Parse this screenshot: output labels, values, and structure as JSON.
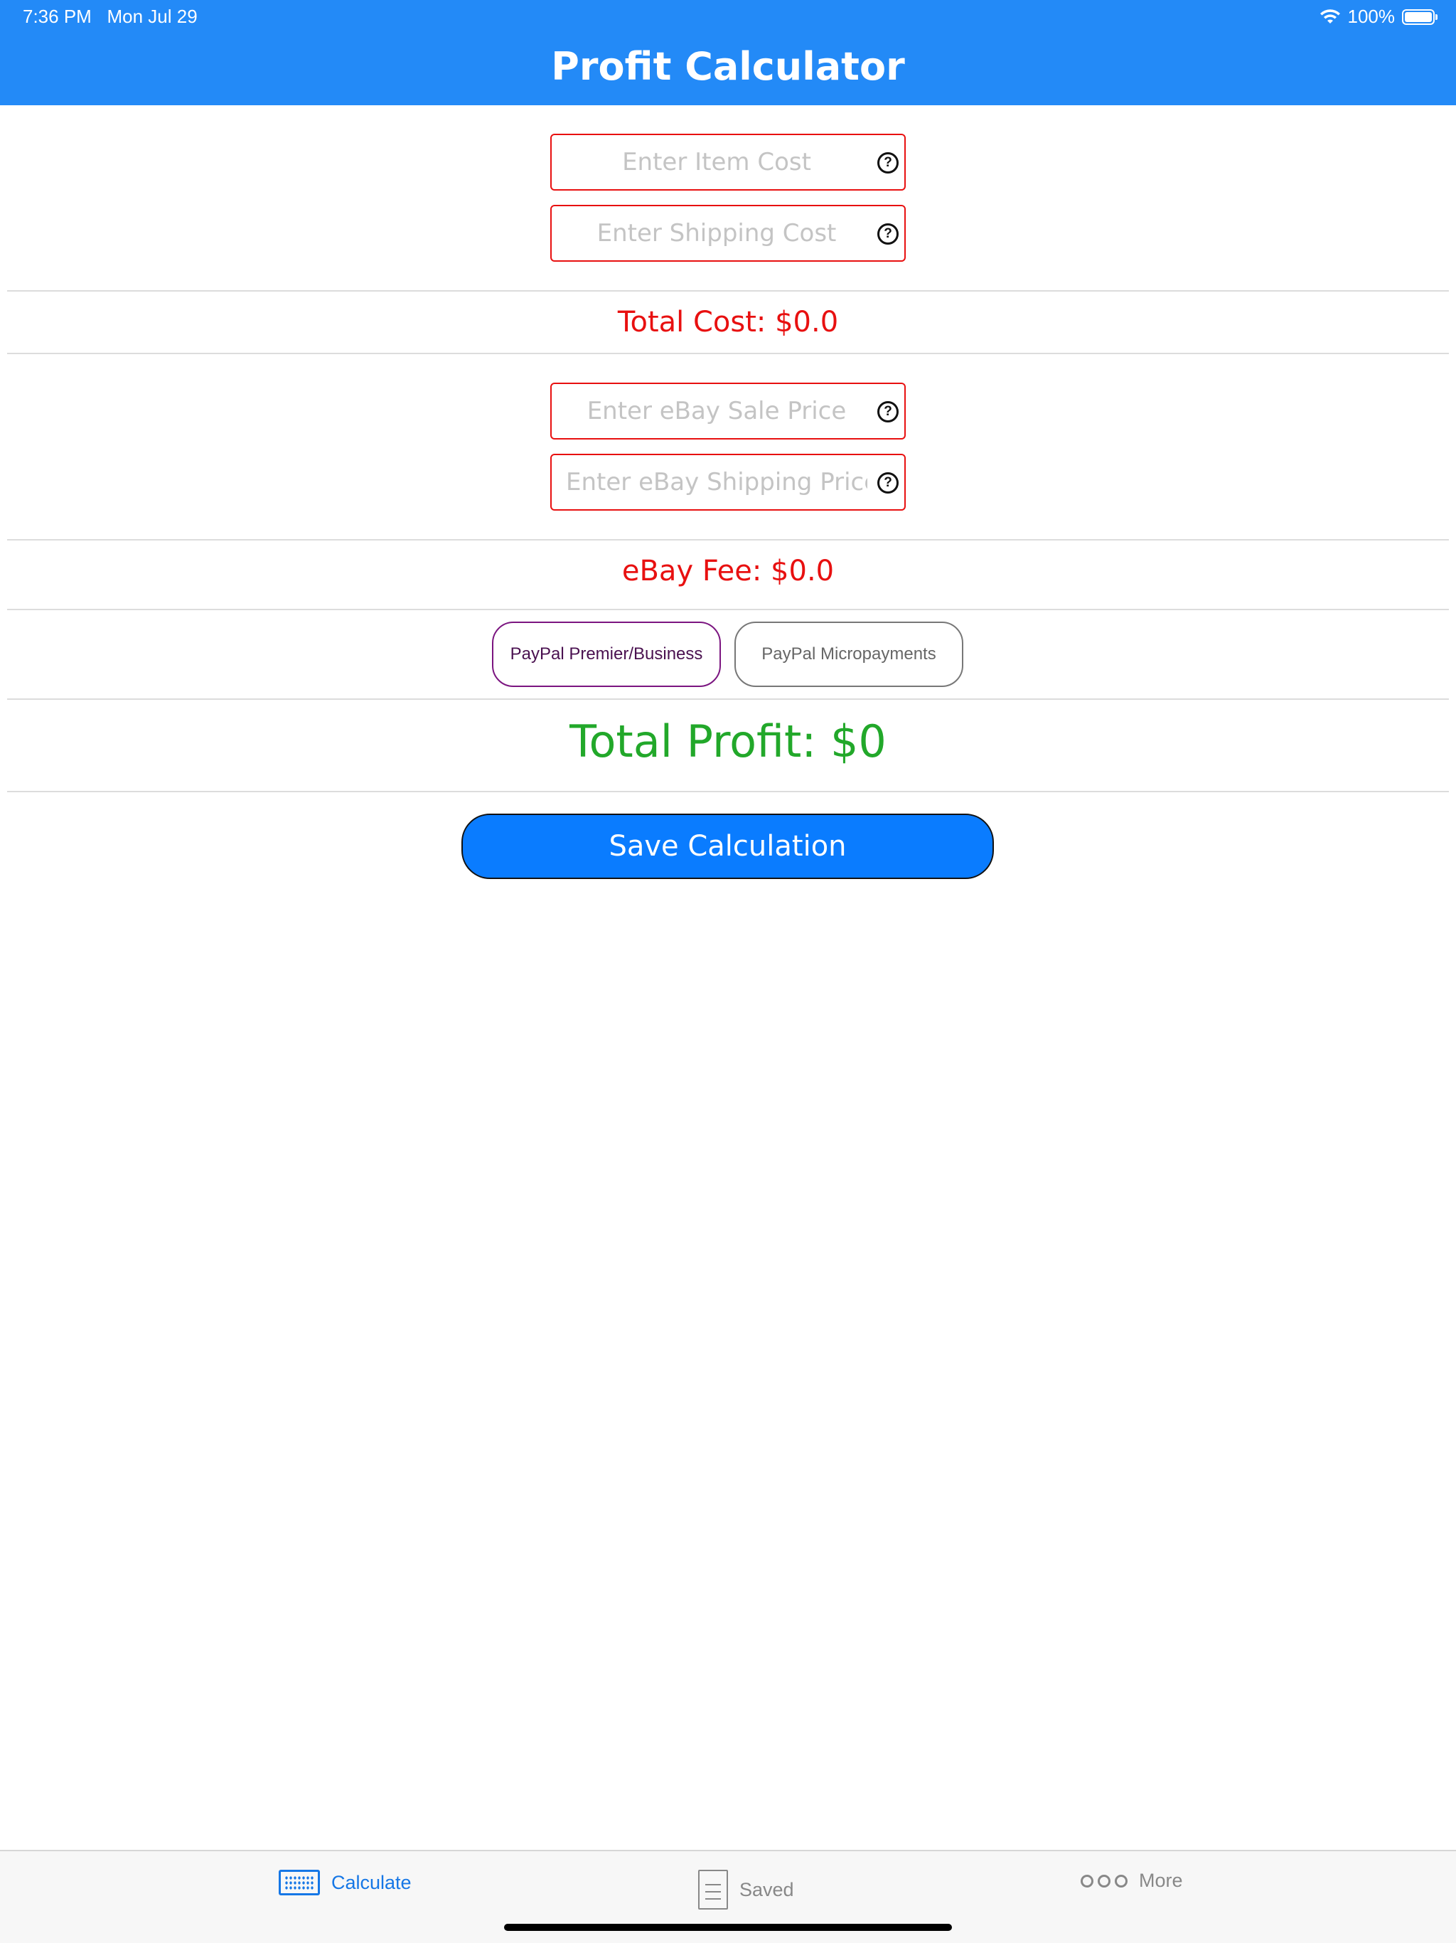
{
  "status_bar": {
    "time": "7:36 PM",
    "date": "Mon Jul 29",
    "battery": "100%"
  },
  "header": {
    "title": "Profit Calculator",
    "bg_color": "#238af7"
  },
  "inputs": {
    "item_cost_placeholder": "Enter Item Cost",
    "shipping_cost_placeholder": "Enter Shipping Cost",
    "ebay_sale_price_placeholder": "Enter eBay Sale Price",
    "ebay_shipping_price_placeholder": "Enter eBay Shipping Price",
    "help_symbol": "?"
  },
  "results": {
    "total_cost": "Total Cost: $0.0",
    "ebay_fee": "eBay Fee: $0.0",
    "total_profit": "Total Profit: $0"
  },
  "paypal_options": {
    "selected": "PayPal Premier/Business",
    "option_1": "PayPal Premier/Business",
    "option_2": "PayPal Micropayments"
  },
  "actions": {
    "save_label": "Save Calculation"
  },
  "tabbar": {
    "calculate": "Calculate",
    "saved": "Saved",
    "more": "More",
    "active_tab": "Calculate"
  }
}
